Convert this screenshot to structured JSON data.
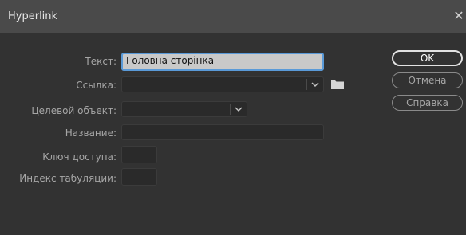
{
  "window": {
    "title": "Hyperlink",
    "close_glyph": "✕"
  },
  "form": {
    "text": {
      "label": "Текст:",
      "value": "Головна сторінка"
    },
    "link": {
      "label": "Ссылка:",
      "value": ""
    },
    "target": {
      "label": "Целевой объект:",
      "value": ""
    },
    "name": {
      "label": "Название:",
      "value": ""
    },
    "access_key": {
      "label": "Ключ доступа:",
      "value": ""
    },
    "tab_index": {
      "label": "Индекс табуляции:",
      "value": ""
    }
  },
  "buttons": {
    "ok": "OK",
    "cancel": "Отмена",
    "help": "Справка"
  },
  "icons": {
    "dropdown": "chevron-down-icon",
    "browse": "folder-icon"
  },
  "colors": {
    "focus": "#5a9ad8",
    "background": "#323232",
    "titlebar": "#4a4a4a"
  }
}
